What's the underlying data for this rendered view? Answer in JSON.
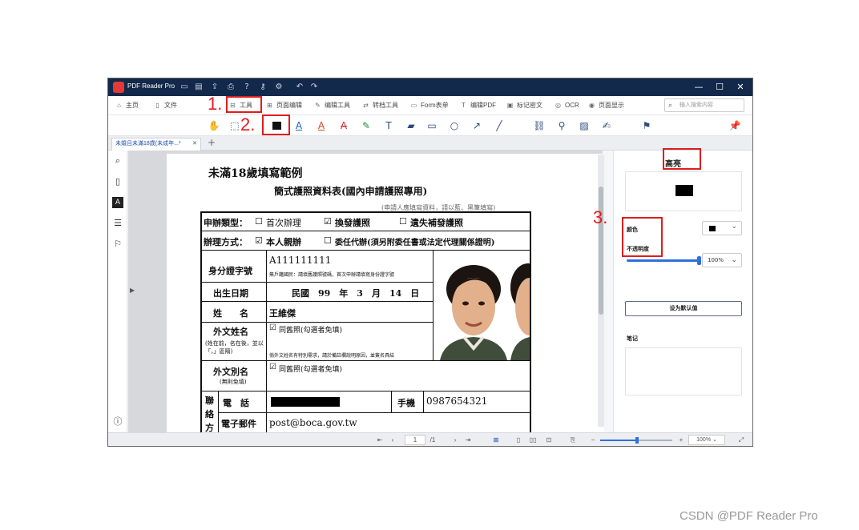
{
  "app": {
    "name": "PDF Reader Pro"
  },
  "menu": {
    "home": "主页",
    "file": "文件",
    "tools": "工具",
    "page_edit": "页面编辑",
    "edit_tools": "编辑工具",
    "convert": "转档工具",
    "form": "Form表单",
    "edit_pdf": "编辑PDF",
    "redact": "标记密文",
    "ocr": "OCR",
    "page_display": "页面显示",
    "search_placeholder": "输入搜索内容"
  },
  "tab": {
    "title": "未婚且未滿18歲(未成年...*"
  },
  "annotations": {
    "a1": "1.",
    "a2": "2.",
    "a3": "3."
  },
  "panel": {
    "title": "高亮",
    "color_label": "颜色",
    "opacity_label": "不透明度",
    "opacity_value": "100%",
    "default_button": "设为默认值",
    "notes_label": "笔记",
    "swatch": "#000000"
  },
  "bottom": {
    "page": "1",
    "total": "/1",
    "zoom": "100%"
  },
  "form": {
    "heading": "未滿18歲填寫範例",
    "title": "簡式護照資料表(國內申請護照專用)",
    "subtitle": "(申請人應填寫資料，請以藍、黑筆填寫)",
    "apply_type_label": "申辦類型：",
    "opt_first": "首次辦理",
    "opt_renew": "換發護照",
    "opt_lost": "遺失補發護照",
    "method_label": "辦理方式：",
    "opt_self": "本人親辦",
    "opt_agent": "委任代辦(須另附委任書或法定代理關係證明)",
    "id_label": "身分證字號",
    "id_value": "A111111111",
    "id_note": "無戶籍國民：請填舊護照號碼，首次申辦請填寫身份證字號",
    "dob_label": "出生日期",
    "dob_value": "民國　99　年　3　月　14　日",
    "name_label": "姓　　名",
    "name_value": "王維傑",
    "foreign_name_label": "外文姓名",
    "foreign_name_note": "(姓在前，名在後，並以「，」區隔)",
    "same_old": "同舊照(勾選者免填)",
    "foreign_special_note": "倘外文姓名有特別需求，請於備註欄說明原因，並簽名具結",
    "alias_label": "外文別名",
    "alias_note": "(無則免填)",
    "contact_label": "聯絡方",
    "phone_label": "電　話",
    "mobile_label": "手機",
    "mobile_value": "0987654321",
    "email_label": "電子郵件",
    "email_value": "post@boca.gov.tw"
  },
  "watermark": "CSDN @PDF Reader Pro"
}
